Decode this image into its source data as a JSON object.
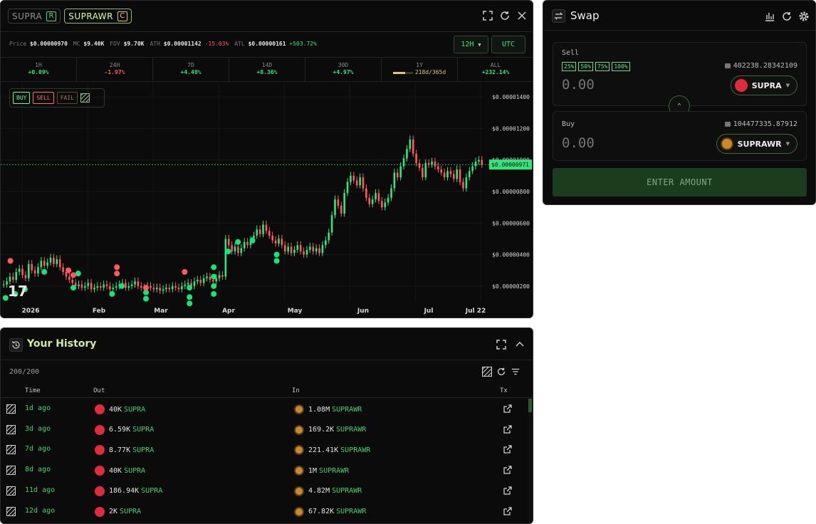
{
  "pair_tabs": [
    {
      "label": "SUPRA",
      "badge": "R"
    },
    {
      "label": "SUPRAWR",
      "badge": "C"
    }
  ],
  "stats": [
    {
      "label": "Price",
      "value": "$0.00000970",
      "change": ""
    },
    {
      "label": "MC",
      "value": "$9.40K",
      "change": ""
    },
    {
      "label": "FDV",
      "value": "$9.70K",
      "change": ""
    },
    {
      "label": "ATH",
      "value": "$0.00001142",
      "change": "-15.03%"
    },
    {
      "label": "ATL",
      "value": "$0.00000161",
      "change": "+503.72%"
    }
  ],
  "interval": {
    "value": "12H"
  },
  "timezone": {
    "value": "UTC"
  },
  "periods": [
    {
      "label": "1H",
      "value": "+0.09%",
      "color": "#2ee879"
    },
    {
      "label": "24H",
      "value": "-1.97%",
      "color": "#ff5a5a"
    },
    {
      "label": "7D",
      "value": "+4.48%",
      "color": "#2ee879"
    },
    {
      "label": "14D",
      "value": "+8.36%",
      "color": "#2ee879"
    },
    {
      "label": "30D",
      "value": "+4.97%",
      "color": "#2ee879"
    },
    {
      "label": "1Y",
      "value": "218d/365d",
      "color": "#e5c76b",
      "progress": 0.6
    },
    {
      "label": "ALL",
      "value": "+232.14%",
      "color": "#2ee879"
    }
  ],
  "trade_filter": {
    "buy": "BUY",
    "sell": "SELL",
    "fail": "FAIL"
  },
  "chart_data": {
    "type": "candlestick",
    "x_ticks": [
      "2026",
      "Feb",
      "Mar",
      "Apr",
      "May",
      "Jun",
      "Jul",
      "Jul 22"
    ],
    "y_ticks": [
      "$0.00001400",
      "$0.00001200",
      "$0.00001000",
      "$0.00000800",
      "$0.00000600",
      "$0.00000400",
      "$0.00000200"
    ],
    "current_price_label": "$0.00000971",
    "ylim": [
      1e-07,
      1.5e-06
    ],
    "close_series": [
      2.1,
      2.3,
      2.6,
      2.4,
      2.9,
      3.1,
      2.7,
      2.5,
      3.4,
      3.0,
      2.8,
      3.2,
      3.6,
      3.3,
      3.5,
      3.8,
      3.4,
      3.7,
      3.2,
      2.9,
      2.6,
      2.4,
      2.2,
      2.0,
      2.1,
      1.9,
      2.0,
      2.2,
      1.8,
      1.9,
      2.0,
      1.9,
      2.1,
      2.0,
      1.8,
      1.9,
      2.0,
      2.1,
      2.2,
      1.9,
      2.0,
      2.1,
      2.3,
      2.0,
      1.9,
      1.8,
      2.0,
      1.9,
      1.8,
      1.9,
      1.7,
      1.8,
      1.9,
      1.8,
      2.0,
      1.9,
      1.8,
      2.0,
      2.1,
      2.2,
      2.0,
      2.3,
      2.4,
      2.2,
      2.5,
      2.6,
      2.4,
      2.3,
      2.5,
      2.7,
      2.6,
      5.0,
      4.6,
      4.2,
      4.5,
      4.1,
      4.4,
      4.8,
      4.6,
      4.9,
      5.2,
      5.6,
      5.3,
      5.9,
      5.5,
      5.2,
      4.9,
      4.7,
      5.0,
      4.6,
      4.2,
      4.5,
      4.1,
      4.3,
      4.6,
      4.2,
      4.0,
      4.3,
      4.5,
      4.2,
      4.4,
      4.1,
      4.6,
      4.9,
      5.4,
      6.5,
      7.5,
      7.1,
      6.6,
      7.9,
      8.6,
      9.0,
      8.7,
      8.4,
      8.9,
      8.2,
      7.6,
      7.2,
      7.5,
      7.9,
      7.4,
      7.0,
      7.3,
      7.6,
      8.2,
      9.2,
      8.9,
      9.6,
      10.1,
      10.7,
      11.3,
      10.4,
      9.8,
      9.5,
      8.9,
      9.8,
      9.7,
      9.9,
      9.6,
      9.4,
      9.2,
      8.9,
      9.3,
      9.1,
      8.8,
      9.4,
      8.6,
      8.2,
      8.9,
      9.3,
      9.6,
      9.9,
      10.0,
      9.7
    ],
    "buy_markers": [
      {
        "x": 0.01,
        "y": 1.25
      },
      {
        "x": 0.03,
        "y": 1.5
      },
      {
        "x": 0.05,
        "y": 1.8
      },
      {
        "x": 0.09,
        "y": 2.9
      },
      {
        "x": 0.15,
        "y": 1.9
      },
      {
        "x": 0.16,
        "y": 2.8
      },
      {
        "x": 0.23,
        "y": 1.5
      },
      {
        "x": 0.25,
        "y": 2.0
      },
      {
        "x": 0.3,
        "y": 1.6
      },
      {
        "x": 0.3,
        "y": 1.2
      },
      {
        "x": 0.39,
        "y": 1.9
      },
      {
        "x": 0.39,
        "y": 1.3
      },
      {
        "x": 0.39,
        "y": 0.9
      },
      {
        "x": 0.44,
        "y": 3.2
      },
      {
        "x": 0.44,
        "y": 2.6
      },
      {
        "x": 0.44,
        "y": 2.0
      },
      {
        "x": 0.44,
        "y": 1.5
      },
      {
        "x": 0.47,
        "y": 4.2
      },
      {
        "x": 0.49,
        "y": 4.8
      },
      {
        "x": 0.52,
        "y": 4.9
      },
      {
        "x": 0.57,
        "y": 4.0
      },
      {
        "x": 0.57,
        "y": 3.6
      }
    ],
    "sell_markers": [
      {
        "x": 0.02,
        "y": 3.6
      },
      {
        "x": 0.14,
        "y": 3.0
      },
      {
        "x": 0.15,
        "y": 2.7
      },
      {
        "x": 0.24,
        "y": 3.2
      },
      {
        "x": 0.24,
        "y": 2.8
      },
      {
        "x": 0.3,
        "y": 1.9
      },
      {
        "x": 0.38,
        "y": 2.9
      }
    ]
  },
  "swap": {
    "title": "Swap",
    "sell_label": "Sell",
    "buy_label": "Buy",
    "pcts": [
      "25%",
      "50%",
      "75%",
      "100%"
    ],
    "sell_balance": "402238.28342109",
    "buy_balance": "104477335.87912",
    "sell_amount": "0.00",
    "buy_amount": "0.00",
    "sell_token": "SUPRA",
    "buy_token": "SUPRAWR",
    "enter_button": "ENTER AMOUNT"
  },
  "history": {
    "title": "Your History",
    "count": "200/200",
    "columns": {
      "time": "Time",
      "out": "Out",
      "in": "In",
      "tx": "Tx"
    },
    "rows": [
      {
        "time": "1d ago",
        "out_amt": "40K",
        "out_sym": "SUPRA",
        "in_amt": "1.08M",
        "in_sym": "SUPRAWR"
      },
      {
        "time": "3d ago",
        "out_amt": "6.59K",
        "out_sym": "SUPRA",
        "in_amt": "169.2K",
        "in_sym": "SUPRAWR"
      },
      {
        "time": "7d ago",
        "out_amt": "8.77K",
        "out_sym": "SUPRA",
        "in_amt": "221.41K",
        "in_sym": "SUPRAWR"
      },
      {
        "time": "8d ago",
        "out_amt": "40K",
        "out_sym": "SUPRA",
        "in_amt": "1M",
        "in_sym": "SUPRAWR"
      },
      {
        "time": "11d ago",
        "out_amt": "186.94K",
        "out_sym": "SUPRA",
        "in_amt": "4.82M",
        "in_sym": "SUPRAWR"
      },
      {
        "time": "12d ago",
        "out_amt": "2K",
        "out_sym": "SUPRA",
        "in_amt": "67.82K",
        "in_sym": "SUPRAWR"
      }
    ]
  },
  "colors": {
    "accent": "#37e57c",
    "sell": "#ff5a5a",
    "bg": "#0b0b0b"
  }
}
